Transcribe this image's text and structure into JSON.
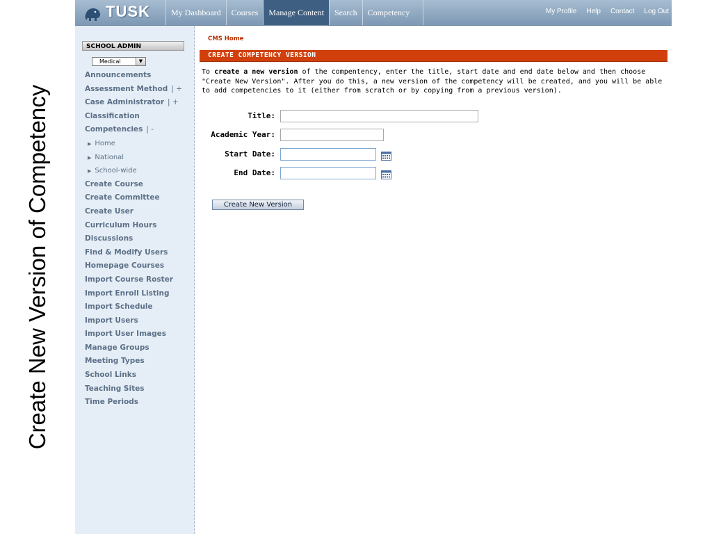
{
  "slide": {
    "title": "Create New Version of Competency"
  },
  "logo": {
    "text": "TUSK"
  },
  "nav": {
    "items": [
      {
        "label": "My Dashboard",
        "active": false
      },
      {
        "label": "Courses",
        "active": false
      },
      {
        "label": "Manage Content",
        "active": true
      },
      {
        "label": "Search",
        "active": false
      },
      {
        "label": "Competency",
        "active": false
      }
    ],
    "util": [
      "My Profile",
      "Help",
      "Contact",
      "Log Out"
    ]
  },
  "sidebar": {
    "title": "SCHOOL ADMIN",
    "school_select": {
      "value": "Medical"
    },
    "items": [
      {
        "label": "Announcements"
      },
      {
        "label": "Assessment Method",
        "toggle": "| +"
      },
      {
        "label": "Case Administrator",
        "toggle": "| +"
      },
      {
        "label": "Classification"
      },
      {
        "label": "Competencies",
        "toggle": "| -"
      },
      {
        "label": "Home",
        "sub": true
      },
      {
        "label": "National",
        "sub": true
      },
      {
        "label": "School-wide",
        "sub": true
      },
      {
        "label": "Create Course"
      },
      {
        "label": "Create Committee"
      },
      {
        "label": "Create User"
      },
      {
        "label": "Curriculum Hours"
      },
      {
        "label": "Discussions"
      },
      {
        "label": "Find & Modify Users"
      },
      {
        "label": "Homepage Courses"
      },
      {
        "label": "Import Course Roster"
      },
      {
        "label": "Import Enroll Listing"
      },
      {
        "label": "Import Schedule"
      },
      {
        "label": "Import Users"
      },
      {
        "label": "Import User Images"
      },
      {
        "label": "Manage Groups"
      },
      {
        "label": "Meeting Types"
      },
      {
        "label": "School Links"
      },
      {
        "label": "Teaching Sites"
      },
      {
        "label": "Time Periods"
      }
    ]
  },
  "main": {
    "breadcrumb": "CMS Home",
    "section_title": "CREATE COMPETENCY VERSION",
    "intro": {
      "part1": "To ",
      "bold": "create a new version",
      "part2": " of the compentency, enter the title, start date and end date below and then choose \"Create New Version\".  After you do this, a new version of the competency will be created, and you will be able to add competencies to it (either from scratch or by copying from a previous version)."
    },
    "form": {
      "title_label": "Title:",
      "title_value": "",
      "year_label": "Academic Year:",
      "year_value": "",
      "start_label": "Start Date:",
      "start_value": "",
      "end_label": "End Date:",
      "end_value": ""
    },
    "submit_label": "Create New Version"
  },
  "colors": {
    "accent": "#d1400c",
    "nav_active": "#3f5f82",
    "sidebar_link": "#5d7088",
    "sidebar_bg": "#e5eef6"
  }
}
